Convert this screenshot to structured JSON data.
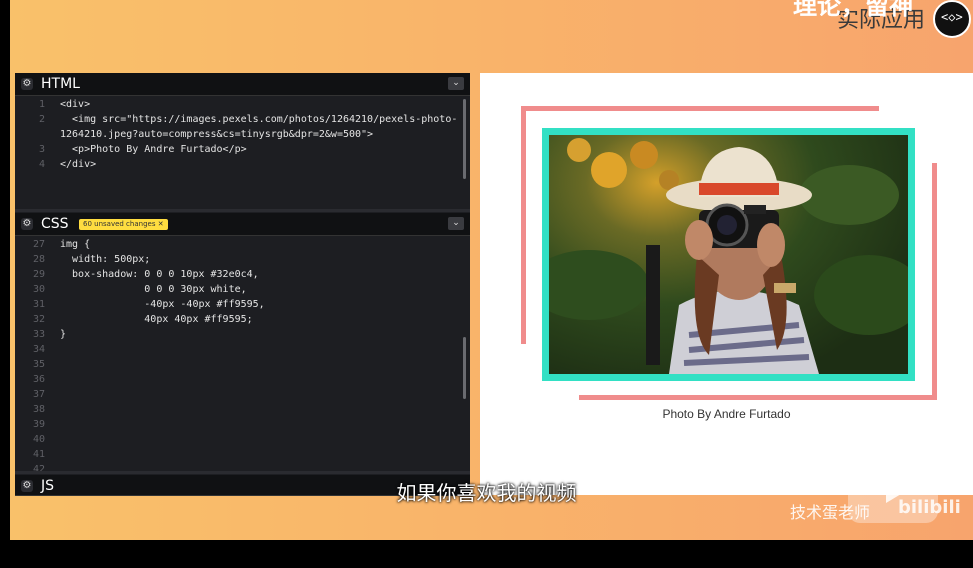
{
  "header": {
    "title_partial": "理论，留神",
    "subtitle": "实际应用",
    "avatar_text": "<◇>"
  },
  "editor": {
    "html_pane": {
      "title": "HTML",
      "lines": [
        {
          "num": "1",
          "text": "<div>"
        },
        {
          "num": "2",
          "text": "  <img src=\"https://images.pexels.com/photos/1264210/pexels-photo-"
        },
        {
          "num": "",
          "text": "1264210.jpeg?auto=compress&cs=tinysrgb&dpr=2&w=500\">"
        },
        {
          "num": "3",
          "text": "  <p>Photo By Andre Furtado</p>"
        },
        {
          "num": "4",
          "text": "</div>"
        }
      ]
    },
    "css_pane": {
      "title": "CSS",
      "badge": "60 unsaved changes ✕",
      "lines": [
        {
          "num": "27",
          "text": "img {"
        },
        {
          "num": "28",
          "text": "  width: 500px;"
        },
        {
          "num": "29",
          "text": "  box-shadow: 0 0 0 10px #32e0c4,"
        },
        {
          "num": "30",
          "text": "              0 0 0 30px white,"
        },
        {
          "num": "31",
          "text": "              -40px -40px #ff9595,"
        },
        {
          "num": "32",
          "text": "              40px 40px #ff9595;"
        },
        {
          "num": "33",
          "text": "}"
        },
        {
          "num": "34",
          "text": ""
        },
        {
          "num": "35",
          "text": ""
        },
        {
          "num": "36",
          "text": ""
        },
        {
          "num": "37",
          "text": ""
        },
        {
          "num": "38",
          "text": ""
        },
        {
          "num": "39",
          "text": ""
        },
        {
          "num": "40",
          "text": ""
        },
        {
          "num": "41",
          "text": ""
        },
        {
          "num": "42",
          "text": ""
        }
      ]
    },
    "js_pane": {
      "title": "JS"
    },
    "settings_icon": "gear-icon",
    "collapse_icon": "chevron-down-icon"
  },
  "preview": {
    "caption": "Photo By Andre Furtado",
    "colors": {
      "teal": "#32e0c4",
      "pink": "#ff9595"
    }
  },
  "overlay": {
    "subtitle": "如果你喜欢我的视频",
    "watermark_author": "技术蛋老师",
    "watermark_site": "bilibili"
  }
}
